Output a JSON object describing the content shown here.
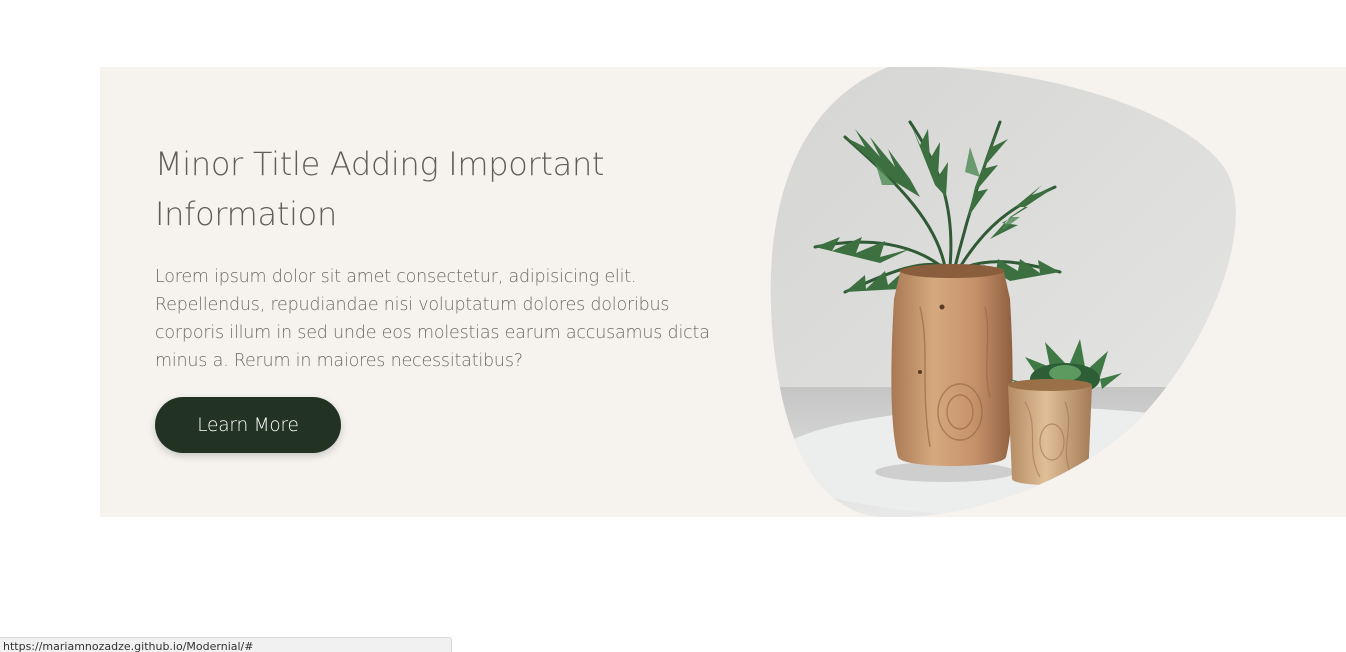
{
  "promo": {
    "title": "Minor Title Adding Important Information",
    "body": "Lorem ipsum dolor sit amet consectetur, adipisicing elit. Repellendus, repudiandae nisi voluptatum dolores doloribus corporis illum in sed unde eos molestias earum accusamus dicta minus a. Rerum in maiores necessitatibus?",
    "button_label": "Learn More",
    "image_alt": "Plants in wooden vases"
  },
  "status_bar": {
    "url": "https://mariamnozadze.github.io/Modernial/#"
  },
  "colors": {
    "section_background": "#f6f3ef",
    "button_background": "#223323",
    "title_text": "#5f5c59",
    "body_text": "#6f6b67"
  }
}
